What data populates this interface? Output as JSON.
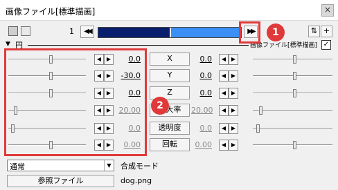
{
  "window": {
    "title": "画像ファイル[標準描画]",
    "close_label": "×"
  },
  "toolbar": {
    "frame": "1",
    "prev_label": "◀◀",
    "next_label": "▶▶",
    "swap_label": "⇅",
    "add_label": "+",
    "icons": [
      "camera-icon",
      "object-icon"
    ],
    "timeline_progress": 0.5
  },
  "group": {
    "name": "円",
    "tag": "画像ファイル[標準描画]",
    "checked": "✓"
  },
  "params": [
    {
      "name": "X",
      "left": "0.0",
      "right": "0.0",
      "dim": false
    },
    {
      "name": "Y",
      "left": "-30.0",
      "right": "0.0",
      "dim": false
    },
    {
      "name": "Z",
      "left": "0.0",
      "right": "0.0",
      "dim": false
    },
    {
      "name": "拡大率",
      "left": "20.00",
      "right": "20.00",
      "dim": true
    },
    {
      "name": "透明度",
      "left": "0.0",
      "right": "0.0",
      "dim": true
    },
    {
      "name": "回転",
      "left": "0.00",
      "right": "0.00",
      "dim": true
    }
  ],
  "arrows": {
    "left": "◀",
    "right": "▶"
  },
  "blend": {
    "value": "通常",
    "label": "合成モード",
    "dropdown": "▼"
  },
  "file": {
    "button": "参照ファイル",
    "name": "dog.png"
  },
  "callouts": [
    "1",
    "2"
  ],
  "colors": {
    "accent_red": "#e0393a",
    "timeline_dark": "#0a1e6e",
    "timeline_light": "#3c8ff5"
  }
}
